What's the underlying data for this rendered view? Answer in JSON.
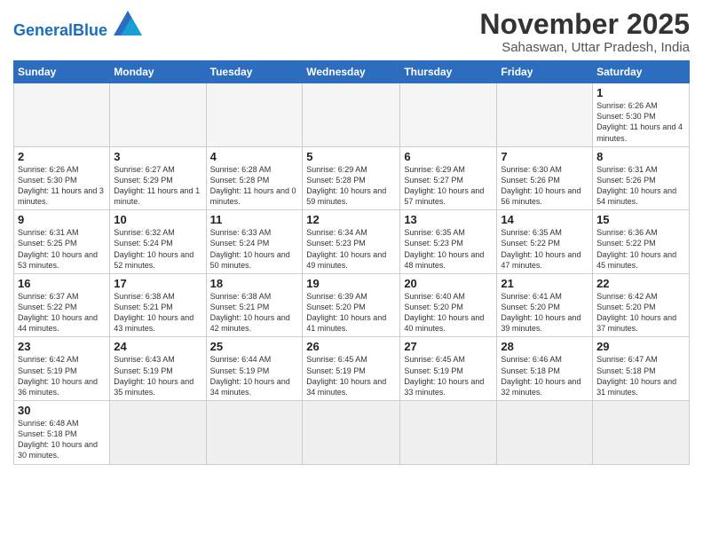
{
  "header": {
    "logo_general": "General",
    "logo_blue": "Blue",
    "month_title": "November 2025",
    "subtitle": "Sahaswan, Uttar Pradesh, India"
  },
  "weekdays": [
    "Sunday",
    "Monday",
    "Tuesday",
    "Wednesday",
    "Thursday",
    "Friday",
    "Saturday"
  ],
  "weeks": [
    [
      {
        "day": "",
        "info": ""
      },
      {
        "day": "",
        "info": ""
      },
      {
        "day": "",
        "info": ""
      },
      {
        "day": "",
        "info": ""
      },
      {
        "day": "",
        "info": ""
      },
      {
        "day": "",
        "info": ""
      },
      {
        "day": "1",
        "info": "Sunrise: 6:26 AM\nSunset: 5:30 PM\nDaylight: 11 hours and 4 minutes."
      }
    ],
    [
      {
        "day": "2",
        "info": "Sunrise: 6:26 AM\nSunset: 5:30 PM\nDaylight: 11 hours and 3 minutes."
      },
      {
        "day": "3",
        "info": "Sunrise: 6:27 AM\nSunset: 5:29 PM\nDaylight: 11 hours and 1 minute."
      },
      {
        "day": "4",
        "info": "Sunrise: 6:28 AM\nSunset: 5:28 PM\nDaylight: 11 hours and 0 minutes."
      },
      {
        "day": "5",
        "info": "Sunrise: 6:29 AM\nSunset: 5:28 PM\nDaylight: 10 hours and 59 minutes."
      },
      {
        "day": "6",
        "info": "Sunrise: 6:29 AM\nSunset: 5:27 PM\nDaylight: 10 hours and 57 minutes."
      },
      {
        "day": "7",
        "info": "Sunrise: 6:30 AM\nSunset: 5:26 PM\nDaylight: 10 hours and 56 minutes."
      },
      {
        "day": "8",
        "info": "Sunrise: 6:31 AM\nSunset: 5:26 PM\nDaylight: 10 hours and 54 minutes."
      }
    ],
    [
      {
        "day": "9",
        "info": "Sunrise: 6:31 AM\nSunset: 5:25 PM\nDaylight: 10 hours and 53 minutes."
      },
      {
        "day": "10",
        "info": "Sunrise: 6:32 AM\nSunset: 5:24 PM\nDaylight: 10 hours and 52 minutes."
      },
      {
        "day": "11",
        "info": "Sunrise: 6:33 AM\nSunset: 5:24 PM\nDaylight: 10 hours and 50 minutes."
      },
      {
        "day": "12",
        "info": "Sunrise: 6:34 AM\nSunset: 5:23 PM\nDaylight: 10 hours and 49 minutes."
      },
      {
        "day": "13",
        "info": "Sunrise: 6:35 AM\nSunset: 5:23 PM\nDaylight: 10 hours and 48 minutes."
      },
      {
        "day": "14",
        "info": "Sunrise: 6:35 AM\nSunset: 5:22 PM\nDaylight: 10 hours and 47 minutes."
      },
      {
        "day": "15",
        "info": "Sunrise: 6:36 AM\nSunset: 5:22 PM\nDaylight: 10 hours and 45 minutes."
      }
    ],
    [
      {
        "day": "16",
        "info": "Sunrise: 6:37 AM\nSunset: 5:22 PM\nDaylight: 10 hours and 44 minutes."
      },
      {
        "day": "17",
        "info": "Sunrise: 6:38 AM\nSunset: 5:21 PM\nDaylight: 10 hours and 43 minutes."
      },
      {
        "day": "18",
        "info": "Sunrise: 6:38 AM\nSunset: 5:21 PM\nDaylight: 10 hours and 42 minutes."
      },
      {
        "day": "19",
        "info": "Sunrise: 6:39 AM\nSunset: 5:20 PM\nDaylight: 10 hours and 41 minutes."
      },
      {
        "day": "20",
        "info": "Sunrise: 6:40 AM\nSunset: 5:20 PM\nDaylight: 10 hours and 40 minutes."
      },
      {
        "day": "21",
        "info": "Sunrise: 6:41 AM\nSunset: 5:20 PM\nDaylight: 10 hours and 39 minutes."
      },
      {
        "day": "22",
        "info": "Sunrise: 6:42 AM\nSunset: 5:20 PM\nDaylight: 10 hours and 37 minutes."
      }
    ],
    [
      {
        "day": "23",
        "info": "Sunrise: 6:42 AM\nSunset: 5:19 PM\nDaylight: 10 hours and 36 minutes."
      },
      {
        "day": "24",
        "info": "Sunrise: 6:43 AM\nSunset: 5:19 PM\nDaylight: 10 hours and 35 minutes."
      },
      {
        "day": "25",
        "info": "Sunrise: 6:44 AM\nSunset: 5:19 PM\nDaylight: 10 hours and 34 minutes."
      },
      {
        "day": "26",
        "info": "Sunrise: 6:45 AM\nSunset: 5:19 PM\nDaylight: 10 hours and 34 minutes."
      },
      {
        "day": "27",
        "info": "Sunrise: 6:45 AM\nSunset: 5:19 PM\nDaylight: 10 hours and 33 minutes."
      },
      {
        "day": "28",
        "info": "Sunrise: 6:46 AM\nSunset: 5:18 PM\nDaylight: 10 hours and 32 minutes."
      },
      {
        "day": "29",
        "info": "Sunrise: 6:47 AM\nSunset: 5:18 PM\nDaylight: 10 hours and 31 minutes."
      }
    ],
    [
      {
        "day": "30",
        "info": "Sunrise: 6:48 AM\nSunset: 5:18 PM\nDaylight: 10 hours and 30 minutes."
      },
      {
        "day": "",
        "info": ""
      },
      {
        "day": "",
        "info": ""
      },
      {
        "day": "",
        "info": ""
      },
      {
        "day": "",
        "info": ""
      },
      {
        "day": "",
        "info": ""
      },
      {
        "day": "",
        "info": ""
      }
    ]
  ]
}
